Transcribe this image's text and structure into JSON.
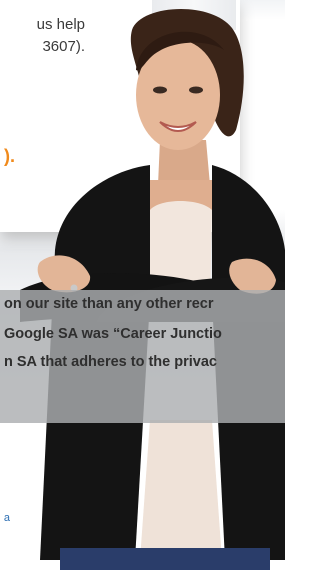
{
  "help": {
    "line1": "us help",
    "line2": "3607)."
  },
  "orange_suffix": ").",
  "banner": {
    "line1": "on our site than any other recr",
    "line2": "Google SA was “Career Junctio",
    "line3": "n SA that adheres to the privac"
  },
  "link_fragment": "a",
  "colors": {
    "accent_orange": "#f08a1c",
    "link_blue": "#2d6fb3",
    "banner_grey": "#acaeb1",
    "jacket": "#121212"
  }
}
